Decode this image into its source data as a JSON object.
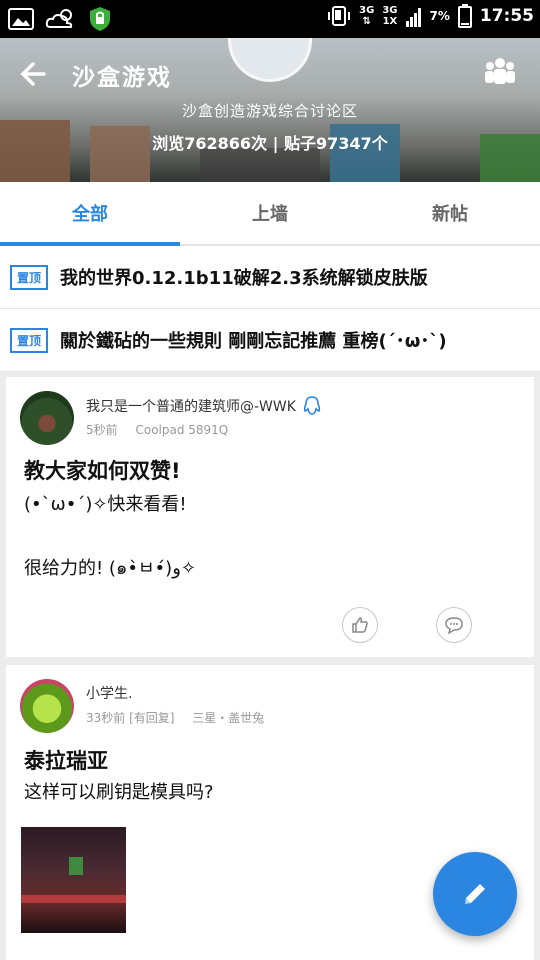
{
  "status_bar": {
    "network": "3G",
    "signal_label_top": "3G",
    "signal_label_bottom": "1X",
    "battery": "7%",
    "time": "17:55"
  },
  "header": {
    "title": "沙盒游戏",
    "subtitle": "沙盒创造游戏综合讨论区",
    "stats": "浏览762866次 | 贴子97347个"
  },
  "tabs": [
    {
      "label": "全部",
      "active": true
    },
    {
      "label": "上墙",
      "active": false
    },
    {
      "label": "新帖",
      "active": false
    }
  ],
  "pinned": [
    {
      "badge": "置顶",
      "title": "我的世界0.12.1b11破解2.3系统解锁皮肤版"
    },
    {
      "badge": "置顶",
      "title": "關於鐵砧的一些規則 剛剛忘記推薦 重榜(´･ω･`)"
    }
  ],
  "posts": [
    {
      "author": "我只是一个普通的建筑师@-WWK",
      "time": "5秒前",
      "device": "Coolpad 5891Q",
      "title": "教大家如何双赞!",
      "lines": [
        "(•`ω•´)✧快来看看!",
        "",
        "很给力的! (๑•̀ㅂ•́)و✧"
      ]
    },
    {
      "author": "小学生.",
      "time": "33秒前 [有回复]",
      "device": "三星・盖世兔",
      "title": "泰拉瑞亚",
      "lines": [
        "这样可以刷钥匙模具吗?"
      ]
    }
  ],
  "colors": {
    "accent": "#2a86e0",
    "status_bar": "#000000",
    "background": "#ececec"
  }
}
